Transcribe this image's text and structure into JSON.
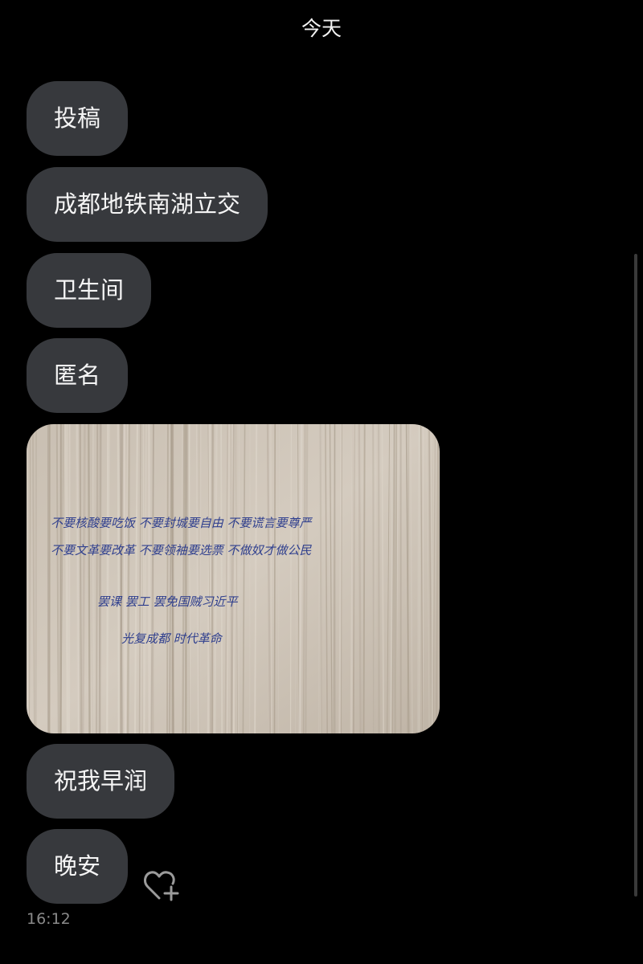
{
  "header": {
    "date": "今天"
  },
  "messages": [
    {
      "text": "投稿"
    },
    {
      "text": "成都地铁南湖立交"
    },
    {
      "text": "卫生间"
    },
    {
      "text": "匿名"
    },
    {
      "text": "祝我早润"
    },
    {
      "text": "晚安"
    }
  ],
  "photo": {
    "line1": "不要核酸要吃饭   不要封城要自由   不要谎言要尊严",
    "line2": "不要文革要改革   不要领袖要选票   不做奴才做公民",
    "line3": "罢课 罢工 罢免国贼习近平",
    "line4": "光复成都  时代革命"
  },
  "footer": {
    "time": "16:12"
  },
  "icons": {
    "react": "heart-plus-icon"
  },
  "colors": {
    "background": "#000000",
    "bubble": "#37393d",
    "text": "#f5f5f5",
    "timestamp": "#8a8a8a",
    "ink": "#2a3a8c"
  }
}
